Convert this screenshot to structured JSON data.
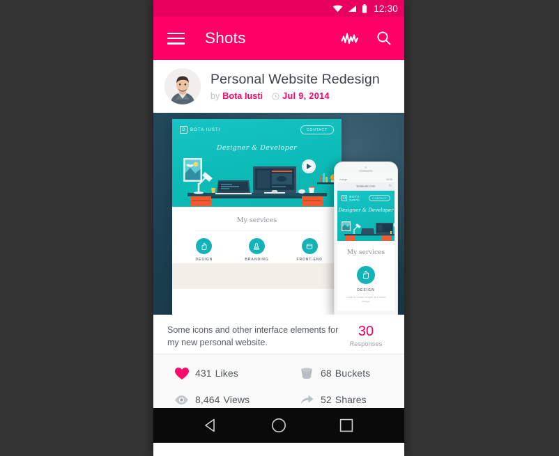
{
  "statusbar": {
    "time": "12:30",
    "icons": [
      "wifi-icon",
      "signal-icon",
      "battery-icon"
    ]
  },
  "appbar": {
    "title": "Shots",
    "menu_icon": "hamburger-menu-icon",
    "activity_icon": "activity-pulse-icon",
    "search_icon": "search-icon",
    "background_color": "#ff0066"
  },
  "shot": {
    "title": "Personal Website Redesign",
    "by_label": "by",
    "author": "Bota Iusti",
    "date": "Jul 9, 2014",
    "clock_icon": "clock-icon",
    "avatar": "user-avatar",
    "description": "Some icons and other interface elements for my new personal website.",
    "responses": {
      "count": "30",
      "label": "Responses"
    },
    "accent_color": "#ff0066",
    "image_background_color": "#1d4254"
  },
  "shot_image": {
    "website_mock": {
      "logo": "BOTA IUSTI",
      "logo_mark": "D",
      "contact_button": "CONTACT",
      "tagline": "Designer & Developer",
      "services_title": "My services",
      "hero_color": "#0dbcb8",
      "services": [
        {
          "name": "DESIGN",
          "icon": "design-hand-icon"
        },
        {
          "name": "BRANDING",
          "icon": "branding-stamp-icon"
        },
        {
          "name": "FRONT-END",
          "icon": "frontend-browser-icon"
        }
      ]
    },
    "phone_mock": {
      "carrier": "orange",
      "clock": "18:30",
      "url": "botaiusti.com",
      "reload_icon": "reload-icon",
      "logo": "BOTA IUSTI",
      "logo_mark": "D",
      "contact_button": "CONTACT",
      "tagline": "Designer & Developer",
      "services_title": "My services",
      "service_name": "DESIGN",
      "service_desc": "I love to create simple and clean design"
    }
  },
  "stats": [
    {
      "icon": "heart-icon",
      "value": "431",
      "label": "Likes",
      "icon_color": "#ff0066"
    },
    {
      "icon": "bucket-icon",
      "value": "68",
      "label": "Buckets",
      "icon_color": "#b7bcc0"
    },
    {
      "icon": "eye-icon",
      "value": "8,464",
      "label": "Views",
      "icon_color": "#b7bcc0"
    },
    {
      "icon": "share-arrow-icon",
      "value": "52",
      "label": "Shares",
      "icon_color": "#b7bcc0"
    }
  ],
  "navbar": {
    "back_icon": "back-triangle-icon",
    "home_icon": "home-circle-icon",
    "recents_icon": "recents-square-icon"
  }
}
